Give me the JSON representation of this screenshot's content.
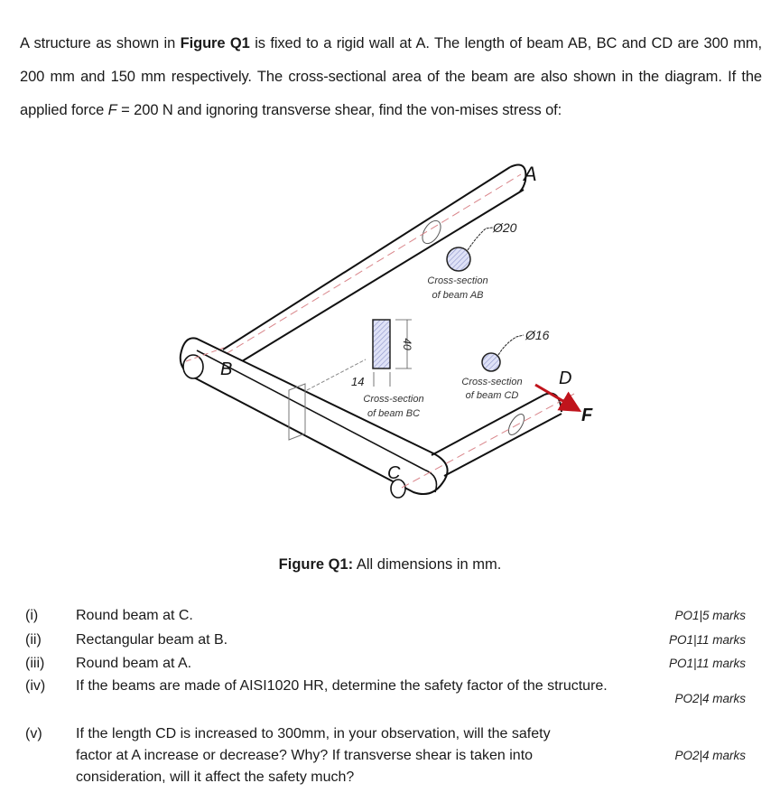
{
  "intro": {
    "part1": "A structure as shown in ",
    "figure_ref": "Figure Q1",
    "part2": " is fixed to a rigid wall at A. The length of beam AB, BC and CD are 300 mm, 200 mm and 150 mm respectively. The cross-sectional area of the beam are also shown in the diagram. If the applied force ",
    "force_symbol": "F",
    "part3": " = 200 N and ignoring transverse shear, find the von-mises stress of:"
  },
  "figure": {
    "labels": {
      "A": "A",
      "B": "B",
      "C": "C",
      "D": "D",
      "F": "F"
    },
    "section_ab": {
      "dim": "Ø20",
      "caption_line1": "Cross-section",
      "caption_line2": "of beam AB"
    },
    "section_bc": {
      "height_dim": "40",
      "width_dim": "14",
      "caption_line1": "Cross-section",
      "caption_line2": "of beam BC"
    },
    "section_cd": {
      "dim": "Ø16",
      "caption_line1": "Cross-section",
      "caption_line2": "of beam CD"
    },
    "colors": {
      "force_arrow": "#c0141c",
      "centerline": "#d9858a",
      "hatch_fill": "#c8cdf0",
      "line": "#111111"
    }
  },
  "caption": {
    "bold": "Figure Q1:",
    "text": " All dimensions in mm."
  },
  "questions": [
    {
      "num": "(i)",
      "text": "Round beam at C.",
      "marks": "PO1|5 marks"
    },
    {
      "num": "(ii)",
      "text": "Rectangular beam at B.",
      "marks": "PO1|11 marks"
    },
    {
      "num": "(iii)",
      "text": "Round beam at A.",
      "marks": "PO1|11 marks"
    },
    {
      "num": "(iv)",
      "text": "If the beams are made of AISI1020 HR, determine the safety factor of the structure.",
      "marks": "PO2|4 marks"
    },
    {
      "num": "(v)",
      "text": "If the length CD is increased to 300mm, in your observation, will the safety factor at A increase or decrease?  Why?  If transverse shear is taken into consideration, will it affect the safety much?",
      "marks": "PO2|4 marks"
    }
  ]
}
